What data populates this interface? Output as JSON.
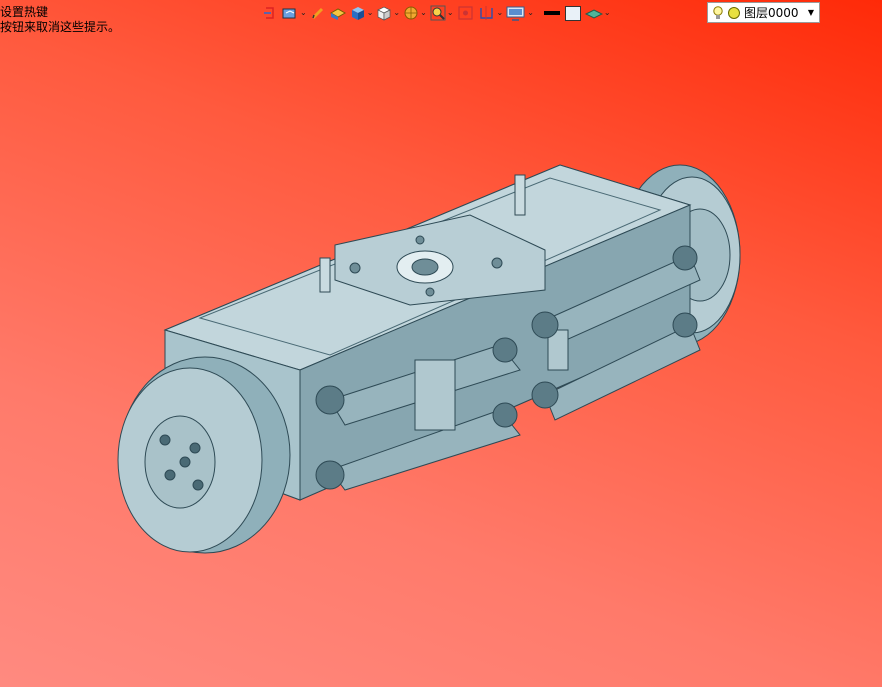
{
  "hint": {
    "line1": "设置热键",
    "line2": "按钮来取消这些提示。"
  },
  "toolbar": {
    "items": [
      {
        "icon": "snap-icon",
        "dropdown": false
      },
      {
        "icon": "view-orient-icon",
        "dropdown": true
      },
      {
        "icon": "pencil-icon",
        "dropdown": false
      },
      {
        "icon": "shade-box-icon",
        "dropdown": false
      },
      {
        "icon": "blue-cube-icon",
        "dropdown": true
      },
      {
        "icon": "white-cube-icon",
        "dropdown": true
      },
      {
        "icon": "render-sphere-icon",
        "dropdown": true
      },
      {
        "icon": "zoom-icon",
        "dropdown": true
      },
      {
        "icon": "fit-view-icon",
        "dropdown": false
      },
      {
        "icon": "section-icon",
        "dropdown": true
      },
      {
        "icon": "display-icon",
        "dropdown": true
      },
      {
        "icon": "color-black-icon",
        "dropdown": false
      },
      {
        "icon": "color-white-icon",
        "dropdown": false
      },
      {
        "icon": "layer-plane-icon",
        "dropdown": true
      }
    ]
  },
  "layer": {
    "value": "图层0000",
    "icons": [
      "lightbulb-icon",
      "layer-color-icon"
    ]
  },
  "colors": {
    "model": "#a9c4cc",
    "model_dark": "#6f8e98",
    "background_top": "#ff2a08",
    "background_bottom": "#ff8a80"
  }
}
